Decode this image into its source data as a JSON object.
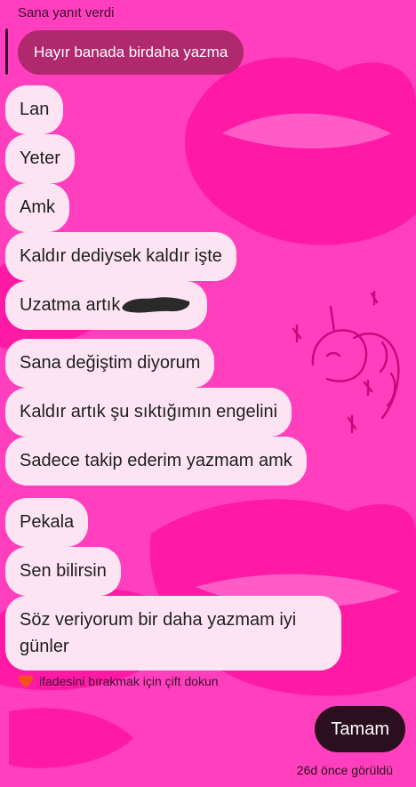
{
  "reply": {
    "caption": "Sana yanıt verdi",
    "quoted_text": "Hayır banada birdaha yazma"
  },
  "messages": [
    {
      "text": "Lan"
    },
    {
      "text": "Yeter"
    },
    {
      "text": "Amk"
    },
    {
      "text": "Kaldır dediysek kaldır işte"
    },
    {
      "text": "Uzatma artık"
    },
    {
      "text": "Sana değiştim diyorum"
    },
    {
      "text": "Kaldır artık şu sıktığımın engelini"
    },
    {
      "text": "Sadece takip ederim yazmam amk"
    },
    {
      "text": "Pekala"
    },
    {
      "text": "Sen bilirsin"
    },
    {
      "text": "Söz veriyorum bir daha yazmam iyi günler"
    }
  ],
  "hint": {
    "icon": "heart-icon",
    "text": "ifadesini bırakmak için çift dokun"
  },
  "reply_button": {
    "label": "Tamam"
  },
  "status": {
    "seen": "26d önce görüldü"
  },
  "colors": {
    "background": "#ff3fbd",
    "received_bubble": "#fde4f3",
    "quoted_bubble": "#b0286e",
    "sent_bubble": "#2b0f1f",
    "lips_pattern": "#ff1aa6"
  }
}
